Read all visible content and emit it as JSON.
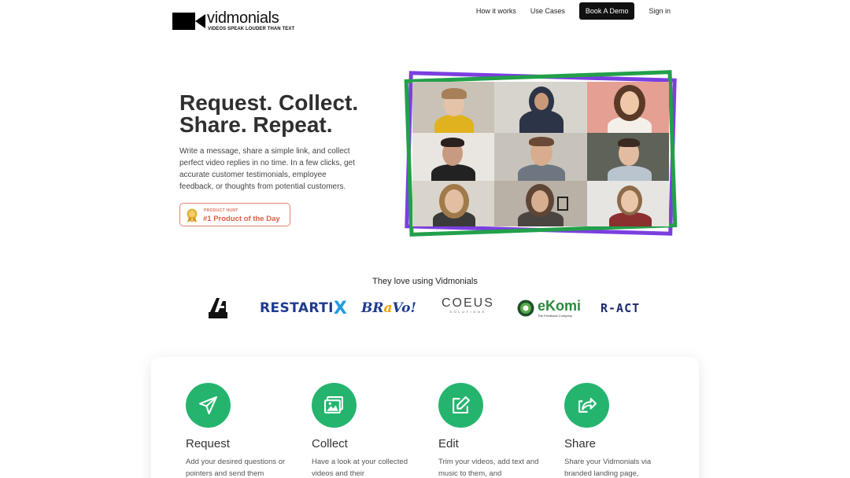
{
  "brand": {
    "name": "vidmonials",
    "tagline": "VIDEOS SPEAK LOUDER THAN TEXT"
  },
  "nav": {
    "links": [
      "How it works",
      "Use Cases"
    ],
    "cta": "Book A Demo",
    "signin": "Sign in"
  },
  "hero": {
    "title_lines": [
      "Request. Collect.",
      "Share. Repeat."
    ],
    "description": "Write a message, share a simple link, and collect perfect video replies in no time. In a few clicks, get accurate customer testimonials, employee feedback, or thoughts from potential customers.",
    "badge": {
      "small": "PRODUCT HUNT",
      "big": "#1 Product of the Day"
    }
  },
  "logos": {
    "heading": "They love using Vidmonials",
    "restartix": "RESTARTI",
    "restartix_x": "X",
    "bravo": "BR",
    "bravo_o": "a",
    "bravo_end": "Vo!",
    "coeus": "COEUS",
    "coeus_sub": "SOLUTIONS",
    "ekomi": "eKomi",
    "ekomi_sub": "The Feedback Company",
    "ract": "R-ACT"
  },
  "features": [
    {
      "title": "Request",
      "desc": "Add your desired questions or pointers and send them"
    },
    {
      "title": "Collect",
      "desc": "Have a look at your collected videos and their"
    },
    {
      "title": "Edit",
      "desc": "Trim your videos, add text and music to them, and"
    },
    {
      "title": "Share",
      "desc": "Share your Vidmonials via branded landing page,"
    }
  ],
  "colors": {
    "accent_green": "#25b46e",
    "frame_purple": "#7b3fdf",
    "frame_green": "#22a04a",
    "badge_red": "#da5e46"
  }
}
